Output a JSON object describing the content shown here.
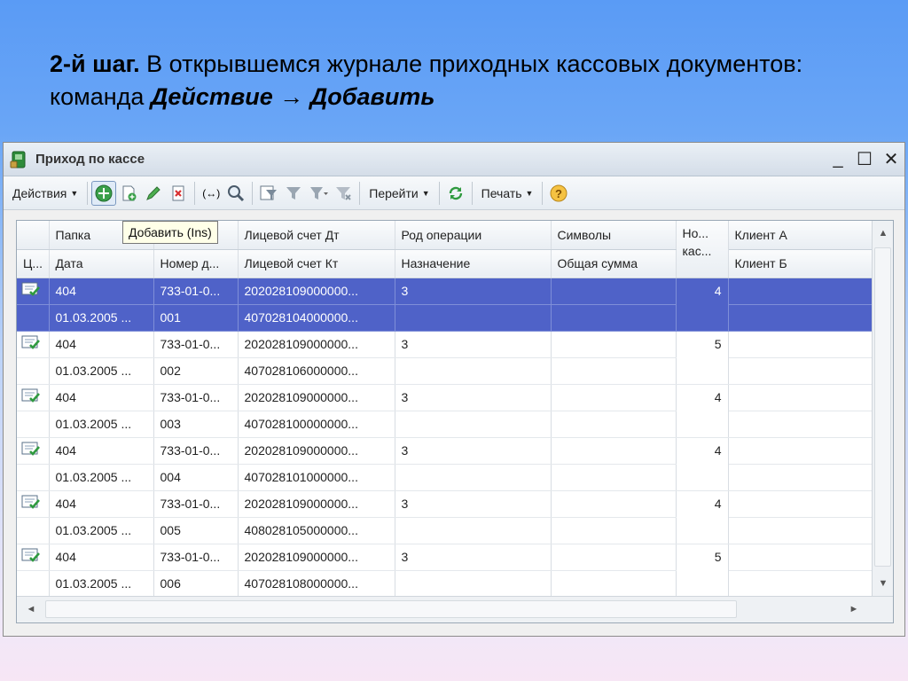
{
  "slide": {
    "step": "2-й шаг.",
    "text_before": " В открывшемся журнале приходных кассовых документов: команда ",
    "cmd1": "Действие",
    "arrow": " → ",
    "cmd2": "Добавить"
  },
  "window": {
    "title": "Приход по кассе",
    "minimize": "_",
    "maximize": "☐",
    "close": "✕"
  },
  "toolbar": {
    "actions_label": "Действия",
    "goto_label": "Перейти",
    "print_label": "Печать",
    "dropdown_glyph": "▼",
    "tool_exchange": "(↔)"
  },
  "tooltip": "Добавить (Ins)",
  "columns": {
    "row1": [
      "",
      "Папка",
      "",
      "Лицевой счет Дт",
      "Род операции",
      "Символы",
      "Но... кас...",
      "Клиент А"
    ],
    "row2": [
      "Ц...",
      "Дата",
      "Номер д...",
      "Лицевой счет Кт",
      "Назначение",
      "Общая сумма",
      "",
      "Клиент Б"
    ]
  },
  "rows": [
    {
      "folder": "404",
      "doc": "733-01-0...",
      "dt": "202028109000000...",
      "op": "3",
      "kas": "4",
      "date": "01.03.2005 ...",
      "num": "001",
      "kt": "407028104000000..."
    },
    {
      "folder": "404",
      "doc": "733-01-0...",
      "dt": "202028109000000...",
      "op": "3",
      "kas": "5",
      "date": "01.03.2005 ...",
      "num": "002",
      "kt": "407028106000000..."
    },
    {
      "folder": "404",
      "doc": "733-01-0...",
      "dt": "202028109000000...",
      "op": "3",
      "kas": "4",
      "date": "01.03.2005 ...",
      "num": "003",
      "kt": "407028100000000..."
    },
    {
      "folder": "404",
      "doc": "733-01-0...",
      "dt": "202028109000000...",
      "op": "3",
      "kas": "4",
      "date": "01.03.2005 ...",
      "num": "004",
      "kt": "407028101000000..."
    },
    {
      "folder": "404",
      "doc": "733-01-0...",
      "dt": "202028109000000...",
      "op": "3",
      "kas": "4",
      "date": "01.03.2005 ...",
      "num": "005",
      "kt": "408028105000000..."
    },
    {
      "folder": "404",
      "doc": "733-01-0...",
      "dt": "202028109000000...",
      "op": "3",
      "kas": "5",
      "date": "01.03.2005 ...",
      "num": "006",
      "kt": "407028108000000..."
    }
  ],
  "selected_row": 0,
  "scroll": {
    "up": "▲",
    "down": "▼",
    "left": "◄",
    "right": "►"
  },
  "colors": {
    "selection": "#4f62c8",
    "slide_bg": "#5a9bf5",
    "add_icon": "#3aa04a"
  },
  "icons": [
    "app-icon",
    "add-icon",
    "copy-icon",
    "edit-icon",
    "delete-icon",
    "search-icon",
    "filter-icon",
    "refresh-icon",
    "help-icon",
    "document-posted-icon"
  ]
}
